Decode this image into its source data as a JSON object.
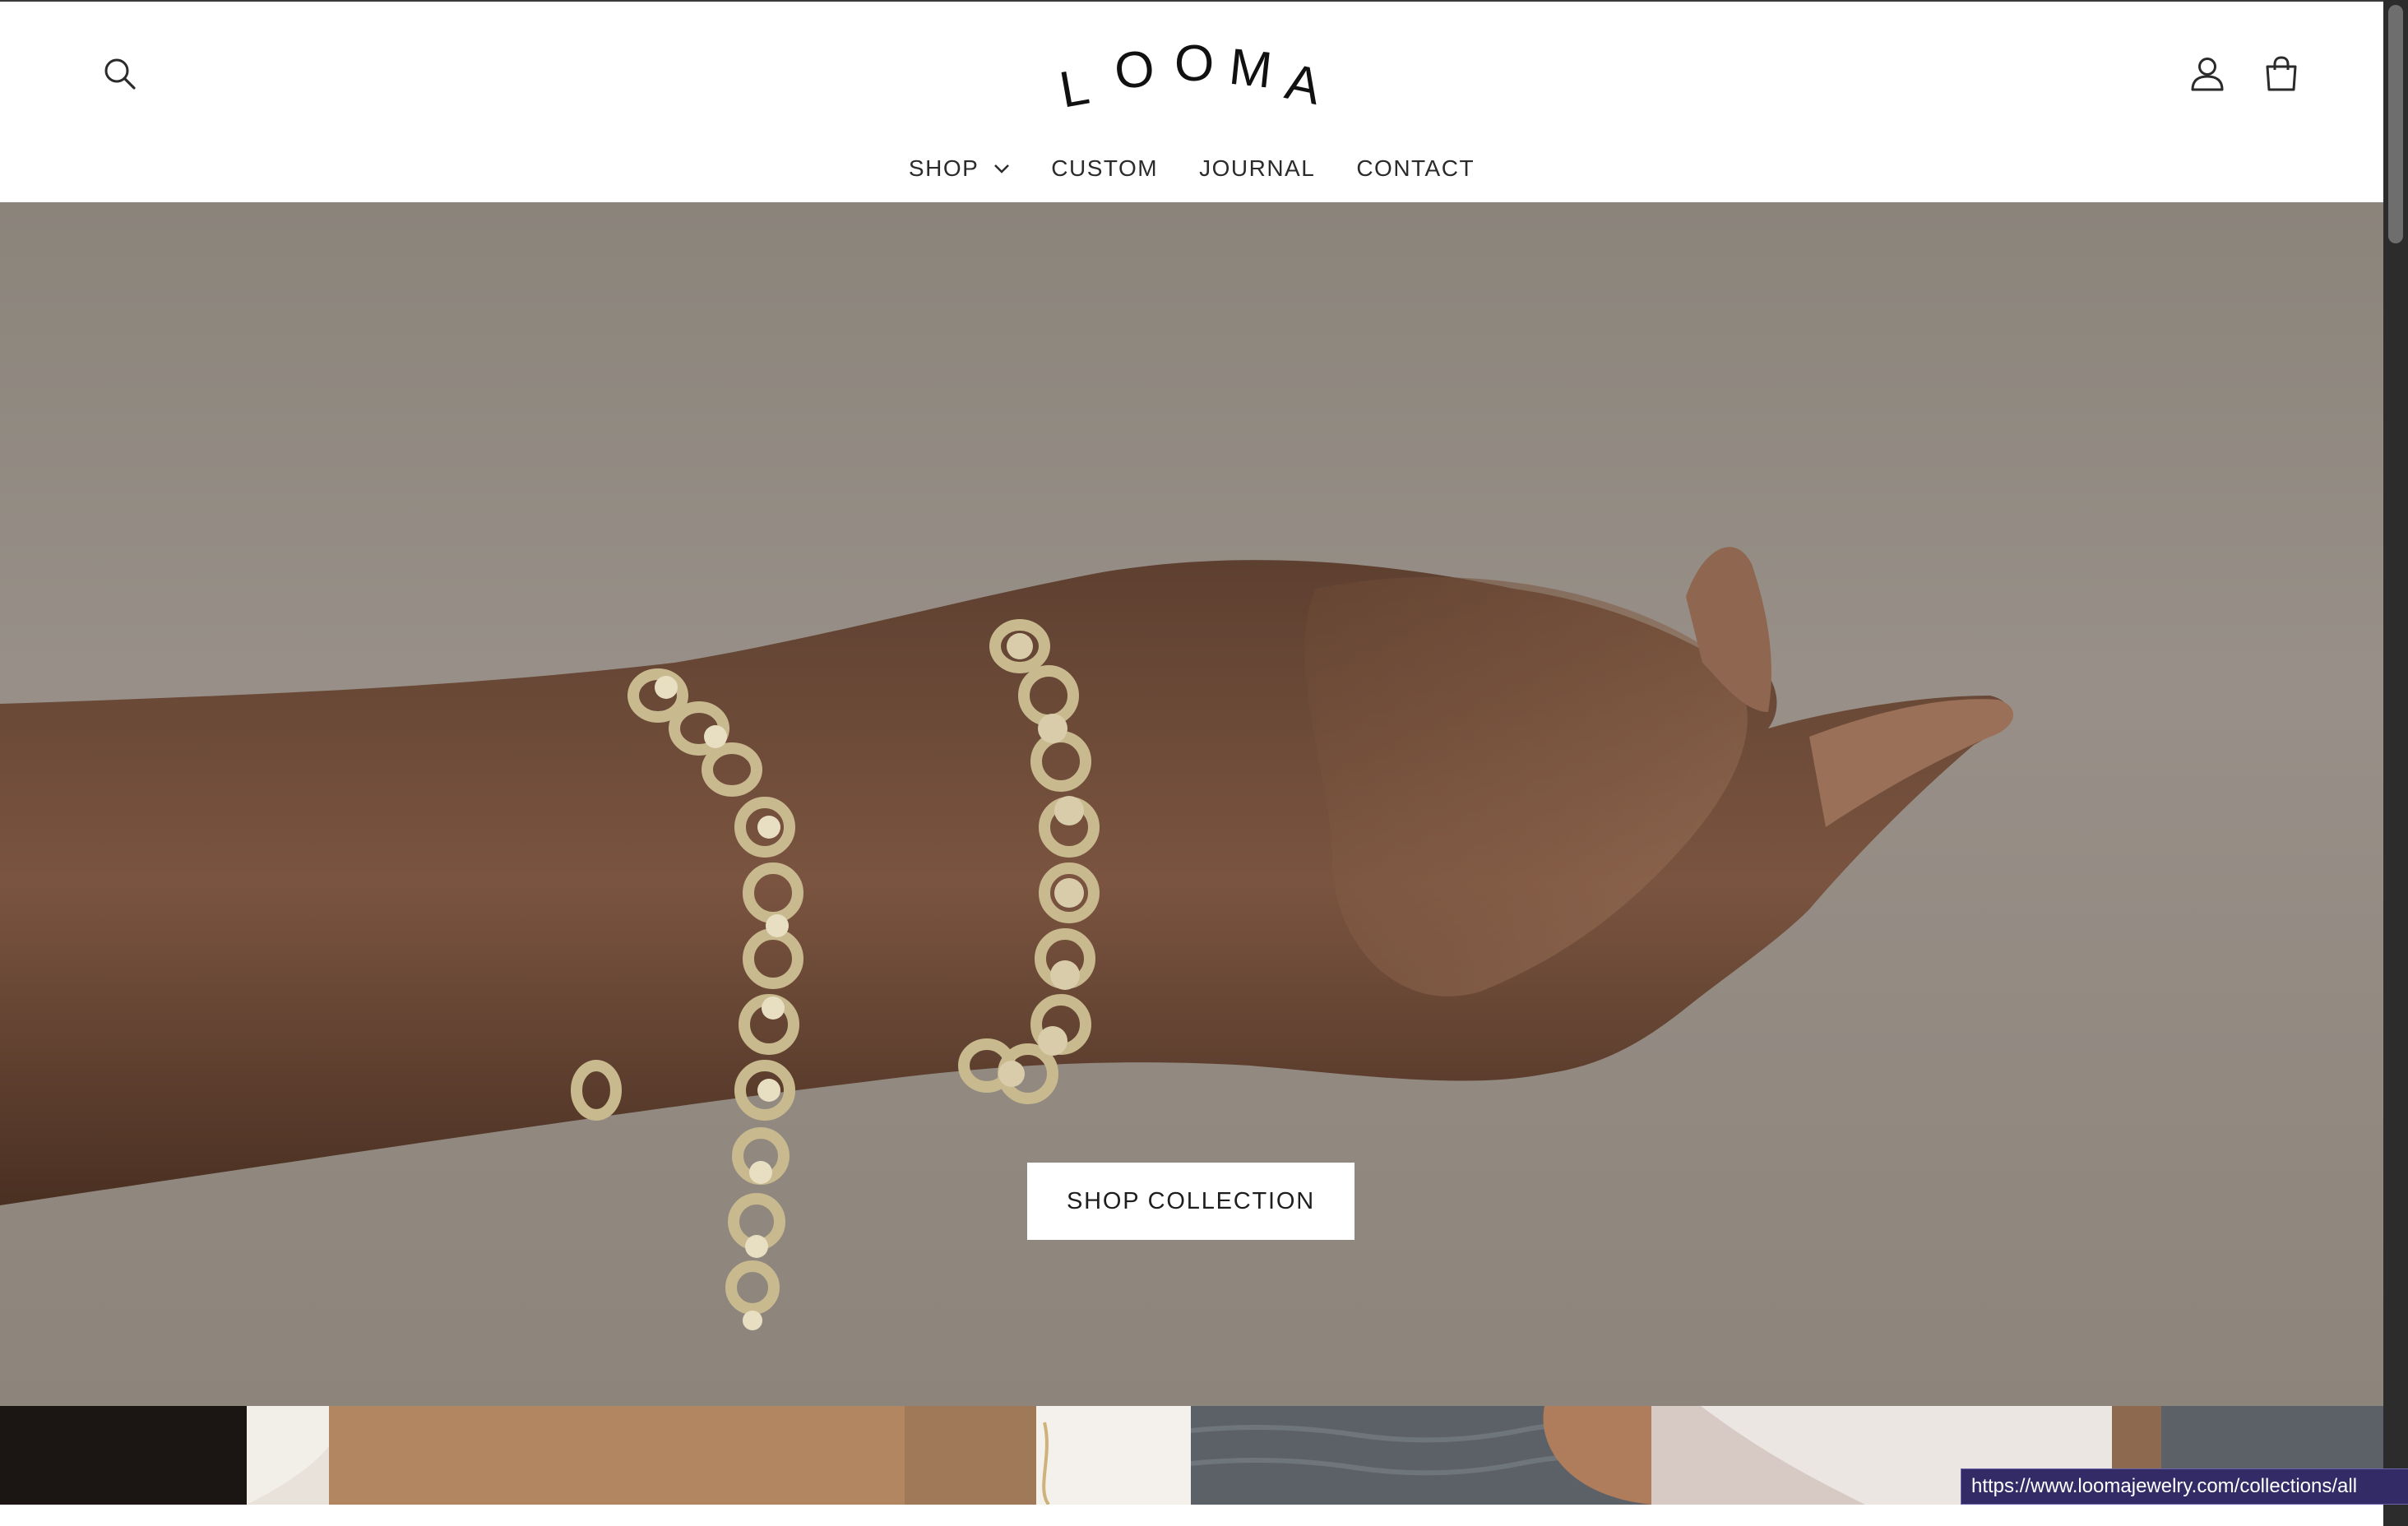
{
  "brand": {
    "logo_text": "LOOMA",
    "logo_letters": [
      "L",
      "O",
      "O",
      "M",
      "A"
    ]
  },
  "header": {
    "search_icon": "search-icon",
    "account_icon": "user-icon",
    "cart_icon": "bag-icon"
  },
  "nav": {
    "items": [
      {
        "label": "SHOP",
        "has_dropdown": true,
        "dropdown_icon": "chevron-down-icon"
      },
      {
        "label": "CUSTOM"
      },
      {
        "label": "JOURNAL"
      },
      {
        "label": "CONTACT"
      }
    ]
  },
  "hero": {
    "cta_label": "SHOP COLLECTION"
  },
  "status_bar": {
    "link_url": "https://www.loomajewelry.com/collections/all"
  },
  "colors": {
    "hero_sand": "#948c83",
    "skin_dark": "#6b4a35",
    "gold": "#c9b98c",
    "status_bg": "#332b66",
    "text_dark": "#2b2b2b"
  }
}
